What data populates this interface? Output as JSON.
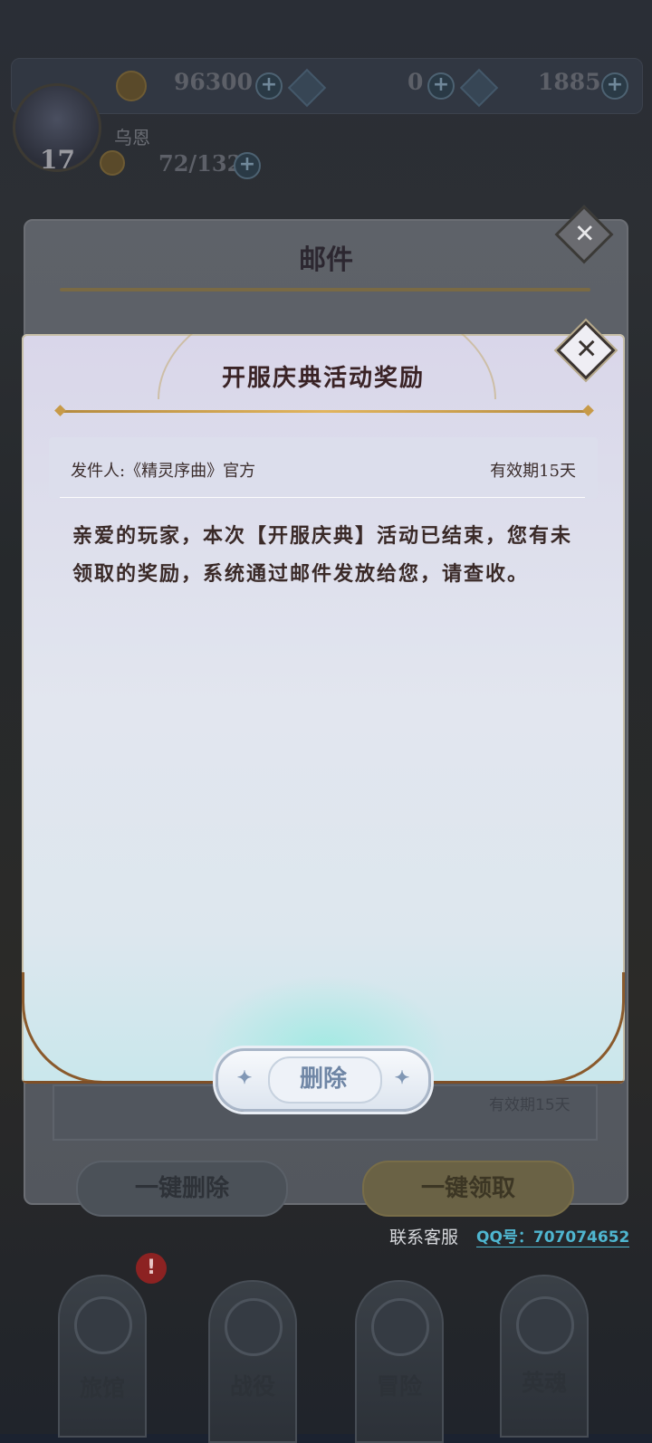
{
  "header": {
    "gold": "96300",
    "currency2": "0",
    "gems": "1885",
    "player_name": "乌恩",
    "level": "17",
    "stamina": "72/132"
  },
  "mail_panel": {
    "title": "邮件",
    "item_expiry": "有效期15天",
    "delete_all_label": "一键删除",
    "claim_all_label": "一键领取"
  },
  "support": {
    "label": "联系客服",
    "qq": "QQ号：707074652"
  },
  "nav": {
    "items": [
      {
        "label": "旅馆"
      },
      {
        "label": "战役"
      },
      {
        "label": "冒险"
      },
      {
        "label": "英魂"
      }
    ],
    "badge": "!"
  },
  "mail_detail": {
    "title": "开服庆典活动奖励",
    "sender": "发件人:《精灵序曲》官方",
    "expiry": "有效期15天",
    "body": "亲爱的玩家，本次【开服庆典】活动已结束，您有未领取的奖励，系统通过邮件发放给您，请查收。",
    "delete_label": "删除"
  },
  "icons": {
    "close": "close-icon",
    "coin": "coin-icon",
    "gem": "gem-icon"
  },
  "colors": {
    "title_text": "#3a2326",
    "gold_rule": "#e1b45c",
    "dialog_bg": "#dcdceb",
    "delete_text": "#6f86a5",
    "qq_link": "#4fb6d0"
  }
}
